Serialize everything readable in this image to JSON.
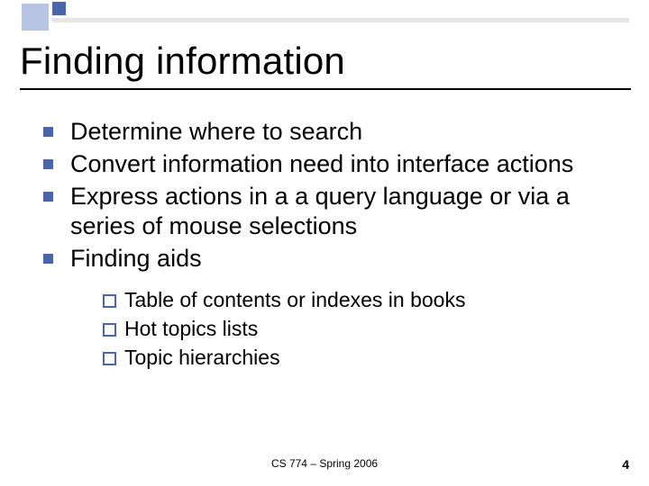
{
  "title": "Finding information",
  "bullets": [
    {
      "text": "Determine where to search"
    },
    {
      "text": "Convert information need into interface actions"
    },
    {
      "text": "Express actions in a a query language or via a series of mouse selections"
    },
    {
      "text": "Finding aids"
    }
  ],
  "sub_bullets": [
    {
      "text": "Table of contents or indexes in books"
    },
    {
      "text": "Hot topics lists"
    },
    {
      "text": "Topic hierarchies"
    }
  ],
  "footer": {
    "center": "CS 774 – Spring 2006",
    "page_number": "4"
  }
}
